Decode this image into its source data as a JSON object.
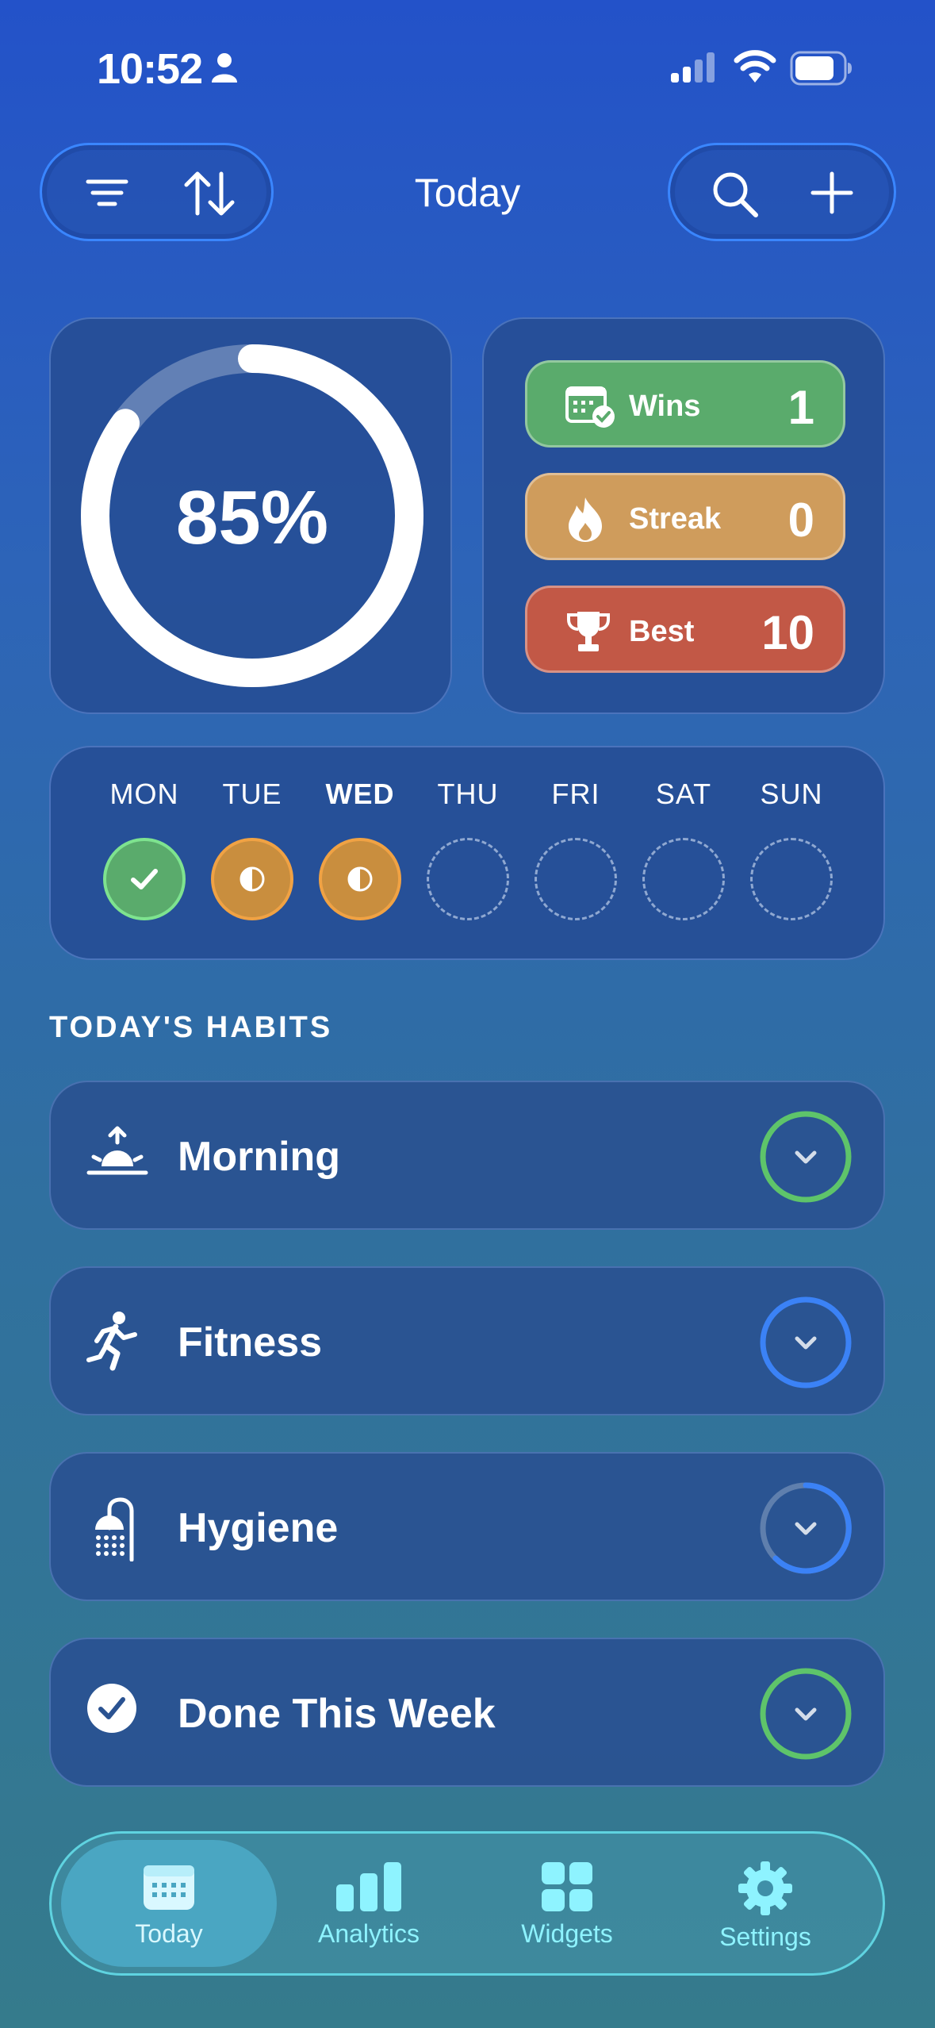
{
  "status": {
    "time": "10:52"
  },
  "nav": {
    "title": "Today"
  },
  "progress": {
    "percent_label": "85%",
    "fraction": 0.85
  },
  "stats": [
    {
      "label": "Wins",
      "value": "1",
      "icon": "calendar-check-icon"
    },
    {
      "label": "Streak",
      "value": "0",
      "icon": "flame-icon"
    },
    {
      "label": "Best",
      "value": "10",
      "icon": "trophy-icon"
    }
  ],
  "week": {
    "days": [
      {
        "label": "MON",
        "state": "done"
      },
      {
        "label": "TUE",
        "state": "partial"
      },
      {
        "label": "WED",
        "state": "partial",
        "today": true
      },
      {
        "label": "THU",
        "state": "empty"
      },
      {
        "label": "FRI",
        "state": "empty"
      },
      {
        "label": "SAT",
        "state": "empty"
      },
      {
        "label": "SUN",
        "state": "empty"
      }
    ]
  },
  "section_heading": "TODAY'S HABITS",
  "habits": [
    {
      "label": "Morning",
      "icon": "sunrise-icon",
      "ring_color": "#5ec46a"
    },
    {
      "label": "Fitness",
      "icon": "running-icon",
      "ring_color": "#3b82f6"
    },
    {
      "label": "Hygiene",
      "icon": "shower-icon",
      "ring_color": "#3b82f6"
    },
    {
      "label": "Done This Week",
      "icon": "checkmark-circle-icon",
      "ring_color": "#5ec46a"
    }
  ],
  "tabs": [
    {
      "label": "Today",
      "icon": "calendar-icon",
      "active": true
    },
    {
      "label": "Analytics",
      "icon": "bar-chart-icon"
    },
    {
      "label": "Widgets",
      "icon": "grid-icon"
    },
    {
      "label": "Settings",
      "icon": "gear-icon"
    }
  ],
  "colors": {
    "accent": "#3a86ff",
    "wins": "#5aab6c",
    "streak": "#cf9c5c",
    "best": "#c25846",
    "tab_accent": "#8ef3ff"
  }
}
